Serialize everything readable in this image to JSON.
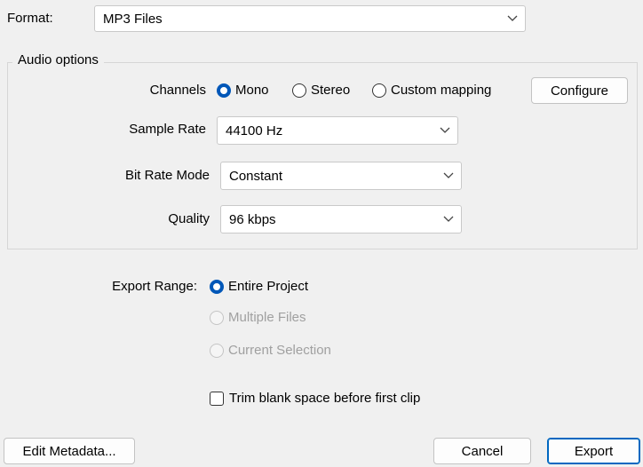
{
  "format": {
    "label": "Format:",
    "value": "MP3 Files"
  },
  "audio_options": {
    "legend": "Audio options",
    "channels": {
      "label": "Channels",
      "options": [
        "Mono",
        "Stereo",
        "Custom mapping"
      ],
      "selected": "Mono",
      "configure_label": "Configure"
    },
    "sample_rate": {
      "label": "Sample Rate",
      "value": "44100 Hz"
    },
    "bit_rate_mode": {
      "label": "Bit Rate Mode",
      "value": "Constant"
    },
    "quality": {
      "label": "Quality",
      "value": "96 kbps"
    }
  },
  "export_range": {
    "label": "Export Range:",
    "options": [
      "Entire Project",
      "Multiple Files",
      "Current Selection"
    ],
    "selected": "Entire Project",
    "disabled": [
      "Multiple Files",
      "Current Selection"
    ]
  },
  "trim": {
    "label": "Trim blank space before first clip",
    "checked": false
  },
  "buttons": {
    "edit_metadata": "Edit Metadata...",
    "cancel": "Cancel",
    "export": "Export"
  },
  "colors": {
    "accent": "#0057b8",
    "background": "#f0f0f0",
    "disabled_text": "#a0a0a0"
  },
  "icons": {
    "dropdown": "chevron-down-icon"
  }
}
